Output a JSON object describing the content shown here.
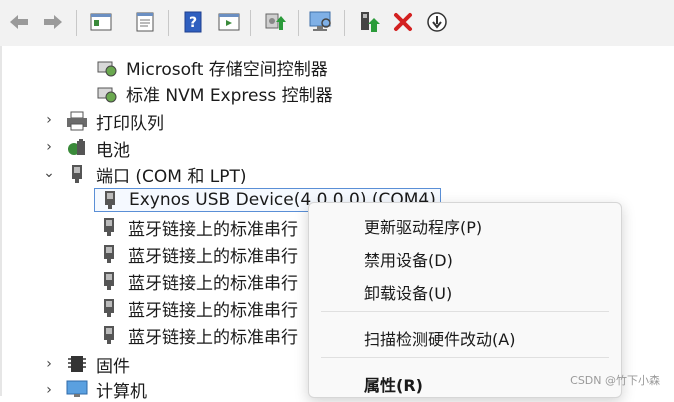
{
  "toolbar": {
    "icons": [
      "back-icon",
      "forward-icon",
      "properties-pane-icon",
      "properties-icon",
      "help-icon",
      "show-hidden-icon",
      "update-driver-icon",
      "scan-hardware-icon",
      "enable-device-icon",
      "uninstall-icon",
      "disable-device-icon"
    ]
  },
  "tree": {
    "storage_items": [
      "Microsoft 存储空间控制器",
      "标准 NVM Express 控制器"
    ],
    "print_queue": "打印队列",
    "battery": "电池",
    "ports": "端口 (COM 和 LPT)",
    "selected_device": "Exynos USB Device(4.0.0.0) (COM4)",
    "bt_ports": [
      "蓝牙链接上的标准串行",
      "蓝牙链接上的标准串行",
      "蓝牙链接上的标准串行",
      "蓝牙链接上的标准串行",
      "蓝牙链接上的标准串行"
    ],
    "firmware": "固件",
    "computer": "计算机"
  },
  "context_menu": {
    "update_driver": "更新驱动程序(P)",
    "disable_device": "禁用设备(D)",
    "uninstall_device": "卸载设备(U)",
    "scan_hardware": "扫描检测硬件改动(A)",
    "properties": "属性(R)"
  },
  "watermark": "CSDN @竹下小森",
  "colors": {
    "accent": "#5a8fd6",
    "uninstall_red": "#d32020",
    "enable_green": "#2b9b3a"
  }
}
